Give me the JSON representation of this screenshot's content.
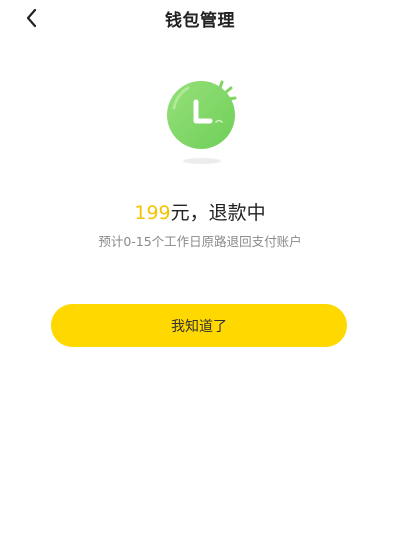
{
  "navbar": {
    "title": "钱包管理",
    "back_icon": "chevron-left-icon"
  },
  "illustration": {
    "icon": "clock-icon",
    "color": "#86d96a"
  },
  "status": {
    "amount": "199",
    "suffix": "元，退款中",
    "amount_color": "#f5c400"
  },
  "hint": "预计0-15个工作日原路退回支付账户",
  "confirm_button": {
    "label": "我知道了",
    "color": "#ffd800"
  }
}
